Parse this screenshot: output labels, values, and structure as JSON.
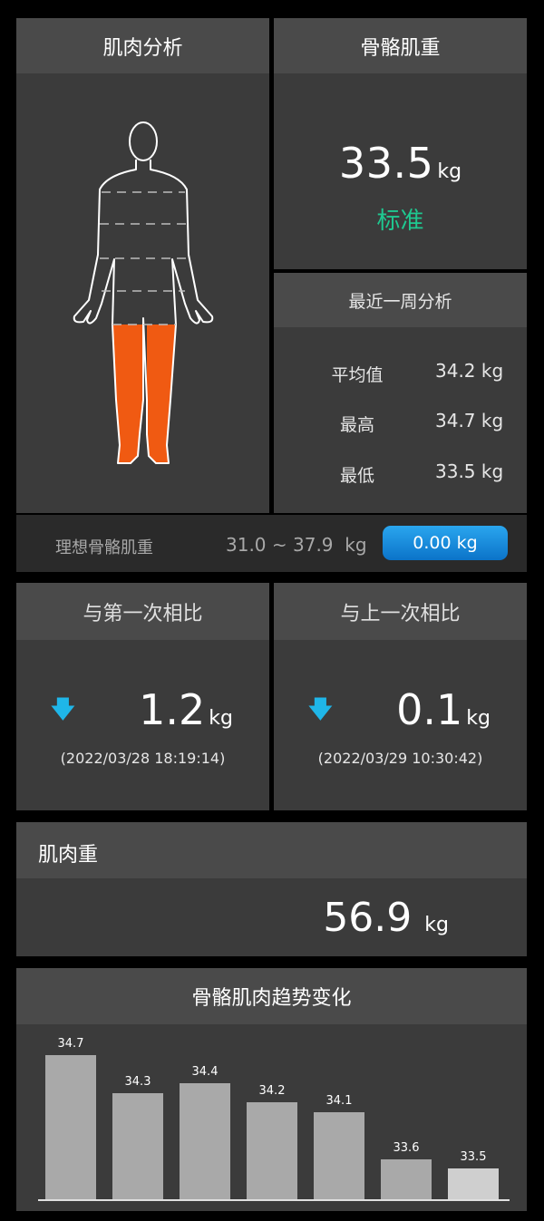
{
  "muscle_analysis": {
    "title": "肌肉分析"
  },
  "skeletal_muscle": {
    "title": "骨骼肌重",
    "value": "33.5",
    "unit": "kg",
    "status": "标准",
    "status_color": "#1fc890"
  },
  "weekly": {
    "title": "最近一周分析",
    "rows": [
      {
        "label": "平均值",
        "value": "34.2 kg"
      },
      {
        "label": "最高",
        "value": "34.7 kg"
      },
      {
        "label": "最低",
        "value": "33.5 kg"
      }
    ]
  },
  "ideal": {
    "label": "理想骨骼肌重",
    "range": "31.0 ~ 37.9  kg",
    "button": "0.00 kg"
  },
  "compare_first": {
    "title": "与第一次相比",
    "value": "1.2",
    "unit": "kg",
    "date": "(2022/03/28 18:19:14)",
    "icon": "arrow-down-icon"
  },
  "compare_last": {
    "title": "与上一次相比",
    "value": "0.1",
    "unit": "kg",
    "date": "(2022/03/29 10:30:42)",
    "icon": "arrow-down-icon"
  },
  "muscle_weight": {
    "title": "肌肉重",
    "value": "56.9",
    "unit": "kg"
  },
  "trend": {
    "title": "骨骼肌肉趋势变化"
  },
  "chart_data": {
    "type": "bar",
    "title": "骨骼肌肉趋势变化",
    "values": [
      34.7,
      34.3,
      34.4,
      34.2,
      34.1,
      33.6,
      33.5
    ],
    "labels": [
      "34.7",
      "34.3",
      "34.4",
      "34.2",
      "34.1",
      "33.6",
      "33.5"
    ],
    "highlight_index": 6,
    "bar_color": "#a9a9a9",
    "highlight_color": "#cfcfcf"
  },
  "colors": {
    "accent_blue": "#1fb6e8",
    "leg_orange": "#f05a12",
    "status_green": "#1fc890"
  }
}
